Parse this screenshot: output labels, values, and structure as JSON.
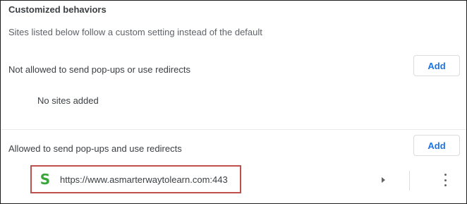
{
  "section": {
    "heading": "Customized behaviors",
    "description": "Sites listed below follow a custom setting instead of the default"
  },
  "blocked": {
    "title": "Not allowed to send pop-ups or use redirects",
    "add_label": "Add",
    "empty_text": "No sites added"
  },
  "allowed": {
    "title": "Allowed to send pop-ups and use redirects",
    "add_label": "Add",
    "sites": [
      {
        "favicon_letter": "S",
        "url": "https://www.asmarterwaytolearn.com:443"
      }
    ]
  },
  "icons": {
    "favicon": "site-favicon-icon",
    "expand": "arrow-right-icon",
    "more": "more-vertical-icon"
  },
  "colors": {
    "accent": "#1a73e8",
    "highlight_border": "#c0504d",
    "favicon": "#3aa53a"
  }
}
